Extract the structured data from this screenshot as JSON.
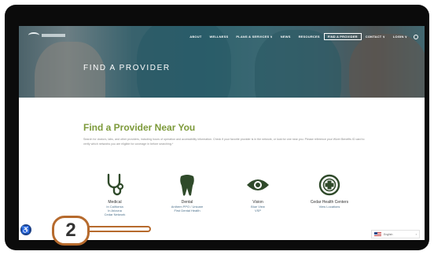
{
  "nav": {
    "items": [
      {
        "label": "ABOUT",
        "boxed": false
      },
      {
        "label": "WELLNESS",
        "boxed": false
      },
      {
        "label": "PLANS & SERVICES ∨",
        "boxed": false
      },
      {
        "label": "NEWS",
        "boxed": false
      },
      {
        "label": "RESOURCES",
        "boxed": false
      },
      {
        "label": "FIND A PROVIDER",
        "boxed": true
      },
      {
        "label": "CONTACT ∨",
        "boxed": false
      },
      {
        "label": "LOGIN ∨",
        "boxed": false
      }
    ],
    "search_icon": "search-icon"
  },
  "hero": {
    "title": "FIND A PROVIDER"
  },
  "main": {
    "title": "Find a Provider Near You",
    "intro": "Search for doctors, labs, and other providers, including hours of operation and accessibility information. Check if your favorite provider is in the network, or look for one near you. Please reference your Wizer Benefits ID card to verify which networks you are eligible for coverage in before searching.*"
  },
  "cards": [
    {
      "icon": "stethoscope-icon",
      "title": "Medical",
      "lines": [
        "In California",
        "In Arizona",
        "Cedar Network"
      ]
    },
    {
      "icon": "tooth-icon",
      "title": "Dental",
      "lines": [
        "Anthem PPO / Unicare",
        "First Dental Health"
      ]
    },
    {
      "icon": "eye-icon",
      "title": "Vision",
      "lines": [
        "Blue View",
        "VSP"
      ]
    },
    {
      "icon": "plus-circle-icon",
      "title": "Cedar Health Centers",
      "lines": [
        "View Locations"
      ]
    }
  ],
  "language": {
    "label": "English",
    "chevron": "›"
  },
  "accessibility": {
    "icon": "accessibility-icon",
    "glyph": "♿"
  },
  "callout": {
    "number": "2"
  },
  "colors": {
    "accent": "#7d9a3b",
    "callout": "#b66a2d",
    "a11y": "#1b3f86"
  }
}
